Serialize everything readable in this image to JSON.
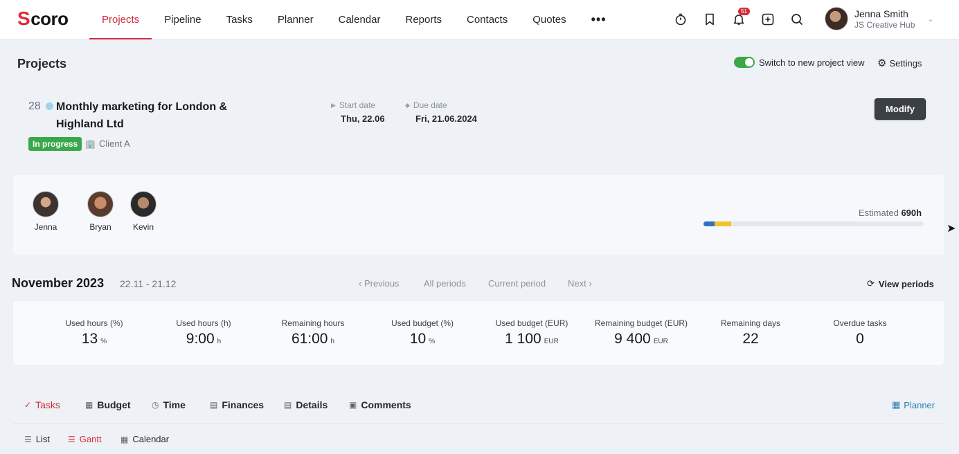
{
  "app": {
    "logo_text": "coro",
    "logo_letter": "S"
  },
  "nav": {
    "items": [
      {
        "label": "Projects",
        "active": true
      },
      {
        "label": "Pipeline"
      },
      {
        "label": "Tasks"
      },
      {
        "label": "Planner"
      },
      {
        "label": "Calendar"
      },
      {
        "label": "Reports"
      },
      {
        "label": "Contacts"
      },
      {
        "label": "Quotes"
      }
    ],
    "more": "•••",
    "notifications_count": "51"
  },
  "user": {
    "name": "Jenna Smith",
    "org": "JS Creative Hub"
  },
  "page": {
    "title": "Projects",
    "toggle_label": "Switch to new project view",
    "toggle_on": true,
    "settings_label": "Settings"
  },
  "project": {
    "id": "28",
    "title": "Monthly marketing for London & Highland Ltd",
    "status": "In progress",
    "client": "Client A",
    "start_label": "Start date",
    "start_value": "Thu, 22.06",
    "due_label": "Due date",
    "due_value": "Fri, 21.06.2024",
    "modify_label": "Modify"
  },
  "team": {
    "members": [
      {
        "name": "Jenna"
      },
      {
        "name": "Bryan"
      },
      {
        "name": "Kevin"
      }
    ],
    "estimated_label": "Estimated",
    "estimated_value": "690h",
    "progress": [
      {
        "color": "#2f72c4",
        "fraction": 0.05
      },
      {
        "color": "#f2c230",
        "fraction": 0.077
      }
    ]
  },
  "period": {
    "title": "November 2023",
    "range": "22.11 - 21.12",
    "previous": "Previous",
    "all": "All periods",
    "current": "Current period",
    "next": "Next",
    "view_periods": "View periods"
  },
  "stats": [
    {
      "label": "Used hours (%)",
      "value": "13",
      "unit": "%"
    },
    {
      "label": "Used hours (h)",
      "value": "9:00",
      "unit": "h"
    },
    {
      "label": "Remaining hours",
      "value": "61:00",
      "unit": "h"
    },
    {
      "label": "Used budget (%)",
      "value": "10",
      "unit": "%"
    },
    {
      "label": "Used budget (EUR)",
      "value": "1 100",
      "unit": "EUR"
    },
    {
      "label": "Remaining budget (EUR)",
      "value": "9 400",
      "unit": "EUR"
    },
    {
      "label": "Remaining days",
      "value": "22",
      "unit": ""
    },
    {
      "label": "Overdue tasks",
      "value": "0",
      "unit": ""
    }
  ],
  "tabs": [
    {
      "label": "Tasks",
      "icon": "check-icon",
      "active": true
    },
    {
      "label": "Budget",
      "icon": "budget-icon"
    },
    {
      "label": "Time",
      "icon": "clock-icon"
    },
    {
      "label": "Finances",
      "icon": "finances-icon"
    },
    {
      "label": "Details",
      "icon": "document-icon"
    },
    {
      "label": "Comments",
      "icon": "comment-icon"
    }
  ],
  "planner_link": "Planner",
  "subtabs": [
    {
      "label": "List",
      "icon": "list-icon"
    },
    {
      "label": "Gantt",
      "icon": "gantt-icon",
      "active": true
    },
    {
      "label": "Calendar",
      "icon": "calendar-icon"
    }
  ],
  "colors": {
    "accent": "#d22c3c",
    "status_green": "#3aa84a",
    "link_blue": "#2c7fb0"
  }
}
